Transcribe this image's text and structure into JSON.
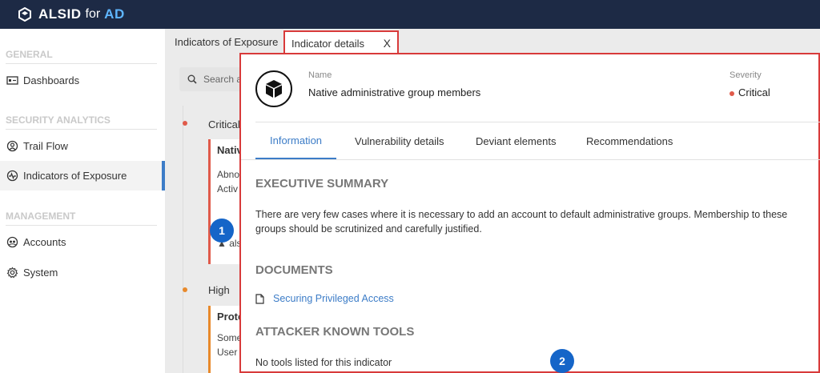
{
  "app": {
    "logo_main": "ALSID",
    "logo_for": "for",
    "logo_ad": "AD"
  },
  "sidebar": {
    "sections": [
      {
        "title": "GENERAL"
      },
      {
        "title": "SECURITY ANALYTICS"
      },
      {
        "title": "MANAGEMENT"
      }
    ],
    "items": [
      {
        "label": "Dashboards",
        "icon": "dashboard-icon"
      },
      {
        "label": "Trail Flow",
        "icon": "trail-flow-icon"
      },
      {
        "label": "Indicators of Exposure",
        "icon": "pulse-icon"
      },
      {
        "label": "Accounts",
        "icon": "accounts-icon"
      },
      {
        "label": "System",
        "icon": "gear-icon"
      }
    ]
  },
  "tabs": [
    {
      "label": "Indicators of Exposure"
    },
    {
      "label": "Indicator details",
      "close": "X"
    }
  ],
  "background": {
    "search_placeholder": "Search a",
    "levels": [
      {
        "label": "Critical",
        "color": "#e05a4a"
      },
      {
        "label": "High",
        "color": "#e8892b"
      }
    ],
    "cards": [
      {
        "title": "Nativ",
        "lines": [
          "Abno",
          "Activ"
        ],
        "footer": "▲ als"
      },
      {
        "title": "Prote",
        "lines": [
          "Some",
          "User"
        ]
      }
    ]
  },
  "badges": [
    "1",
    "2"
  ],
  "details": {
    "name_label": "Name",
    "name_value": "Native administrative group members",
    "severity_label": "Severity",
    "severity_value": "Critical",
    "tabs": [
      {
        "label": "Information"
      },
      {
        "label": "Vulnerability details"
      },
      {
        "label": "Deviant elements"
      },
      {
        "label": "Recommendations"
      }
    ],
    "exec_summary_title": "EXECUTIVE SUMMARY",
    "exec_summary_text": "There are very few cases where it is necessary to add an account to default administrative groups. Membership to these groups should be scrutinized and carefully justified.",
    "documents_title": "DOCUMENTS",
    "document_link": "Securing Privileged Access",
    "tools_title": "ATTACKER KNOWN TOOLS",
    "tools_text": "No tools listed for this indicator"
  }
}
